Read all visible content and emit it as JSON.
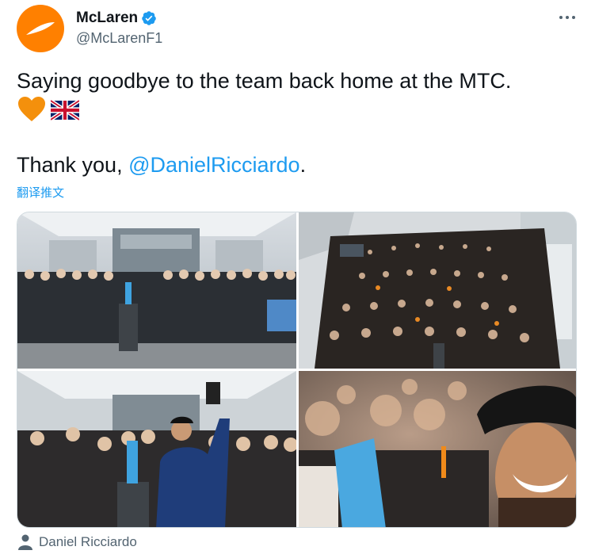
{
  "tweet": {
    "display_name": "McLaren",
    "handle": "@McLarenF1",
    "text_line1": "Saying goodbye to the team back home at the MTC.",
    "text_thanks_prefix": "Thank you, ",
    "mention": "@DanielRicciardo",
    "text_thanks_suffix": ".",
    "translate_label": "翻译推文",
    "tagged_user": "Daniel Ricciardo"
  },
  "icons": {
    "avatar": "mclaren-logo",
    "verified": "verified-badge-icon",
    "more": "more-icon",
    "emoji1": "orange-heart-emoji",
    "emoji2": "uk-flag-emoji",
    "tag": "user-tag-icon"
  },
  "colors": {
    "brand": "#ff8000",
    "link": "#1d9bf0",
    "secondary_text": "#536471"
  }
}
